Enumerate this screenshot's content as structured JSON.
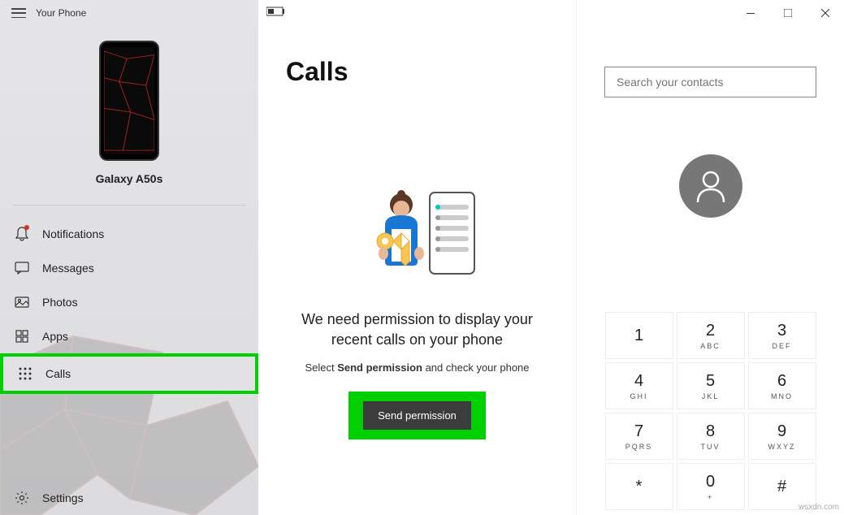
{
  "titlebar": {
    "app_title": "Your Phone"
  },
  "phone": {
    "name": "Galaxy A50s"
  },
  "nav": {
    "notifications": "Notifications",
    "messages": "Messages",
    "photos": "Photos",
    "apps": "Apps",
    "calls": "Calls",
    "settings": "Settings"
  },
  "main": {
    "title": "Calls",
    "perm_heading": "We need permission to display your recent calls on your phone",
    "perm_sub_pre": "Select ",
    "perm_sub_bold": "Send permission",
    "perm_sub_post": " and check your phone",
    "send_btn": "Send permission"
  },
  "right": {
    "search_placeholder": "Search your contacts",
    "dial": [
      {
        "num": "1",
        "letters": ""
      },
      {
        "num": "2",
        "letters": "ABC"
      },
      {
        "num": "3",
        "letters": "DEF"
      },
      {
        "num": "4",
        "letters": "GHI"
      },
      {
        "num": "5",
        "letters": "JKL"
      },
      {
        "num": "6",
        "letters": "MNO"
      },
      {
        "num": "7",
        "letters": "PQRS"
      },
      {
        "num": "8",
        "letters": "TUV"
      },
      {
        "num": "9",
        "letters": "WXYZ"
      },
      {
        "num": "*",
        "letters": ""
      },
      {
        "num": "0",
        "letters": "+"
      },
      {
        "num": "#",
        "letters": ""
      }
    ]
  },
  "watermark": "wsxdn.com"
}
